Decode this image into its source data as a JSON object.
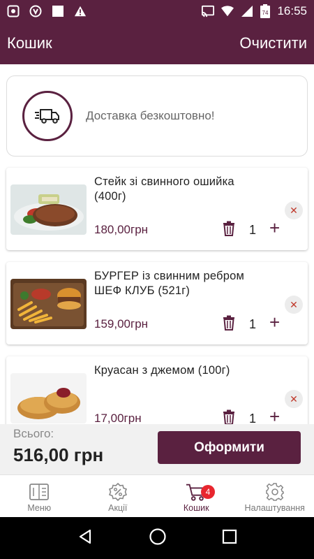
{
  "status_bar": {
    "time": "16:55",
    "battery_level": "74",
    "icons": [
      "screen-record-icon",
      "shield-icon",
      "square-icon",
      "warning-icon",
      "cast-icon",
      "wifi-icon",
      "signal-icon",
      "battery-icon"
    ]
  },
  "app_bar": {
    "title": "Кошик",
    "clear_label": "Очистити"
  },
  "delivery": {
    "icon": "truck-icon",
    "text": "Доставка безкоштовно!"
  },
  "cart_items": [
    {
      "name": "Стейк зі свинного ошийка (400г)",
      "price": "180,00грн",
      "quantity": "1",
      "image": "steak-photo"
    },
    {
      "name": "БУРГЕР із свинним ребром ШЕФ КЛУБ (521г)",
      "price": "159,00грн",
      "quantity": "1",
      "image": "burger-photo"
    },
    {
      "name": "Круасан з джемом (100г)",
      "price": "17,00грн",
      "quantity": "1",
      "image": "croissant-photo"
    }
  ],
  "item_controls": {
    "remove_symbol": "✕",
    "plus_symbol": "+"
  },
  "summary": {
    "total_label": "Всього:",
    "total_value": "516,00 грн",
    "checkout_label": "Оформити"
  },
  "bottom_nav": {
    "items": [
      {
        "label": "Меню",
        "icon": "menu-book-icon"
      },
      {
        "label": "Акції",
        "icon": "discount-icon"
      },
      {
        "label": "Кошик",
        "icon": "cart-icon",
        "badge": "4",
        "active": true
      },
      {
        "label": "Налаштування",
        "icon": "gear-icon"
      }
    ]
  },
  "colors": {
    "primary": "#5a2140",
    "badge": "#e8262f",
    "remove": "#c0392b"
  }
}
